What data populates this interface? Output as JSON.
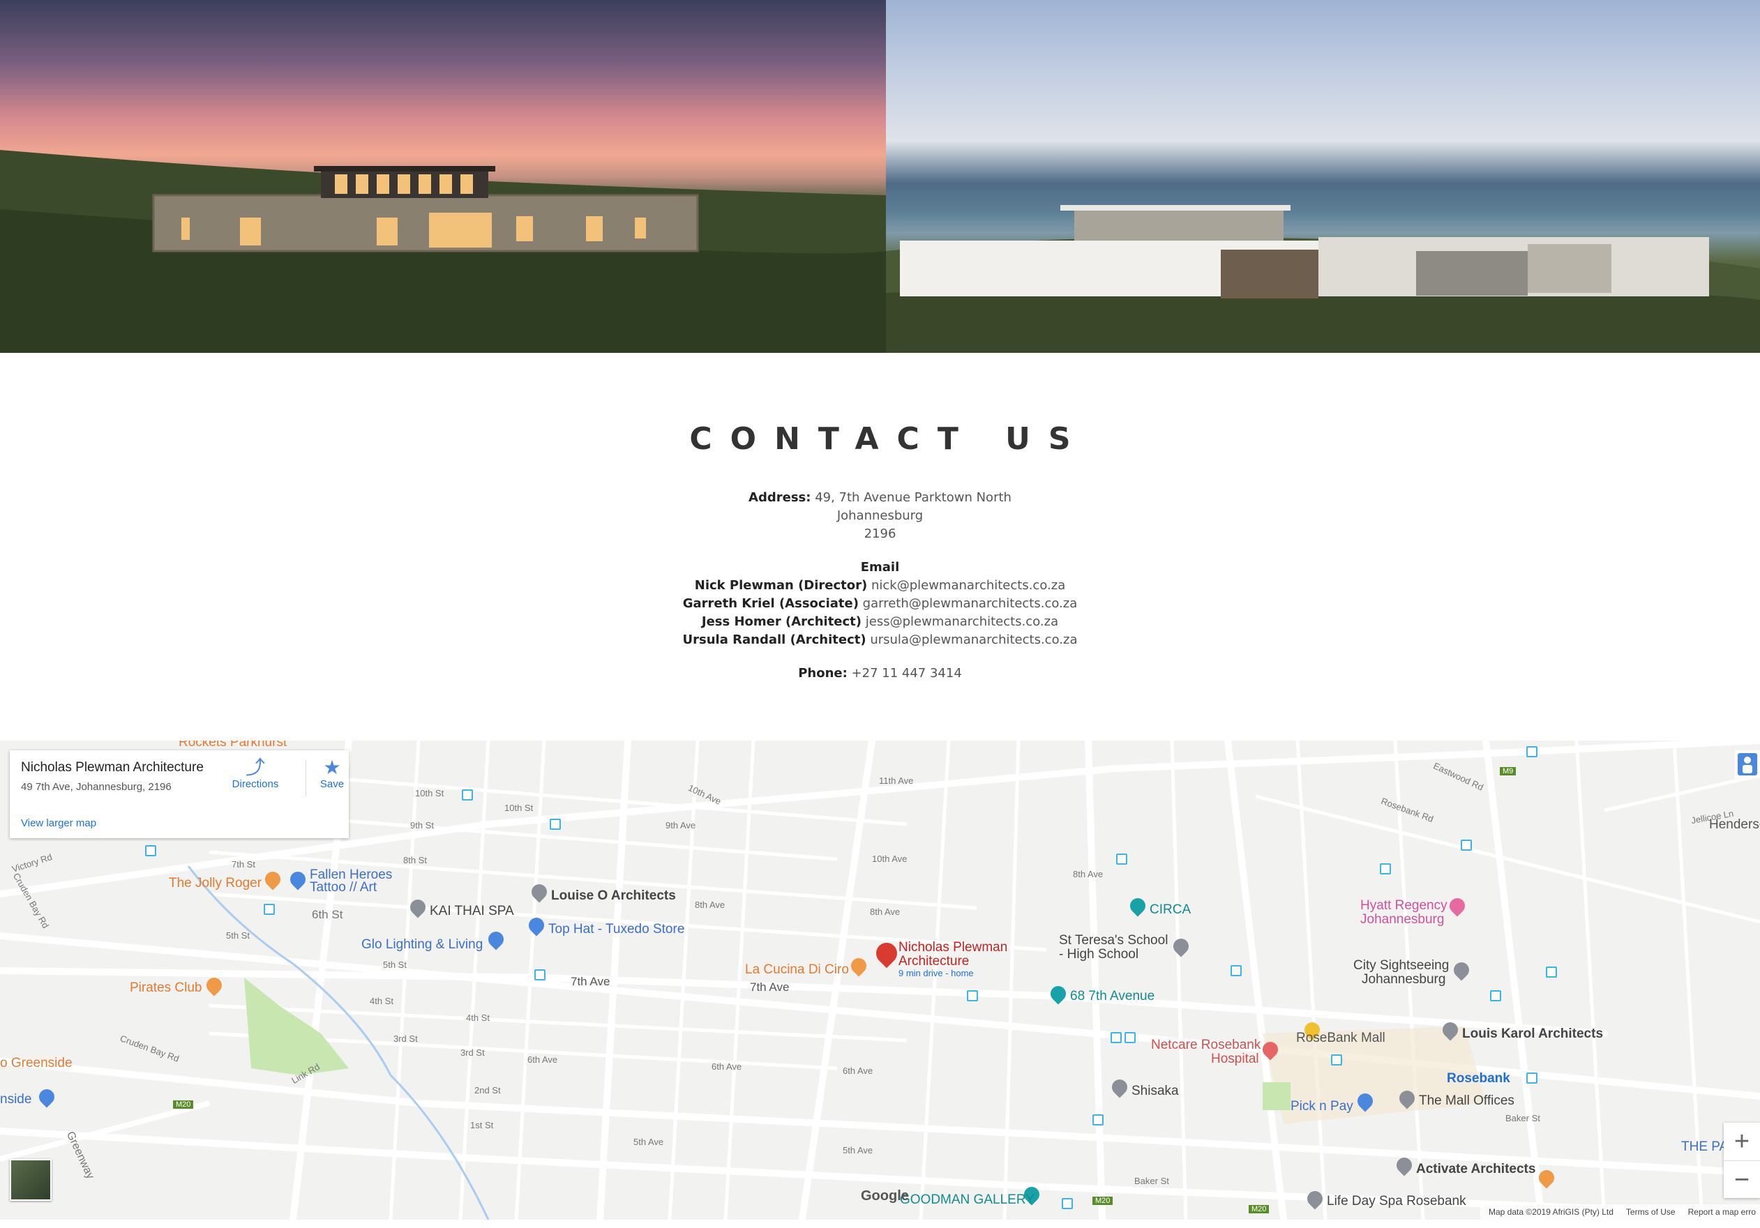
{
  "contact": {
    "title": "CONTACT US",
    "address_label": "Address:",
    "address_line1": "49, 7th Avenue Parktown North",
    "address_line2": "Johannesburg",
    "address_line3": "2196",
    "email_heading": "Email",
    "emails": [
      {
        "name": "Nick Plewman (Director)",
        "email": "nick@plewmanarchitects.co.za"
      },
      {
        "name": "Garreth Kriel (Associate)",
        "email": "garreth@plewmanarchitects.co.za"
      },
      {
        "name": "Jess Homer (Architect)",
        "email": "jess@plewmanarchitects.co.za"
      },
      {
        "name": "Ursula Randall (Architect)",
        "email": "ursula@plewmanarchitects.co.za"
      }
    ],
    "phone_label": "Phone:",
    "phone": "+27 11 447 3414"
  },
  "map": {
    "card": {
      "title": "Nicholas Plewman Architecture",
      "address": "49 7th Ave, Johannesburg, 2196",
      "directions": "Directions",
      "save": "Save",
      "larger_map": "View larger map"
    },
    "marker": {
      "name_line1": "Nicholas Plewman",
      "name_line2": "Architecture",
      "sub": "9 min drive - home"
    },
    "pois": {
      "jolly_roger": "The Jolly Roger",
      "fallen_heroes": "Fallen Heroes",
      "fallen_heroes2": "Tattoo // Art",
      "kai_thai": "KAI THAI SPA",
      "louise": "Louise O Architects",
      "top_hat": "Top Hat - Tuxedo Store",
      "glo": "Glo Lighting & Living",
      "pirates": "Pirates Club",
      "la_cucina": "La Cucina Di Ciro",
      "circa": "CIRCA",
      "teresa1": "St Teresa's School",
      "teresa2": "- High School",
      "ave68": "68 7th Avenue",
      "hyatt1": "Hyatt Regency",
      "hyatt2": "Johannesburg",
      "city1": "City Sightseeing",
      "city2": "Johannesburg",
      "rosebank_mall": "RoseBank Mall",
      "louis_karol": "Louis Karol Architects",
      "netcare1": "Netcare Rosebank",
      "netcare2": "Hospital",
      "rosebank": "Rosebank",
      "shisaka": "Shisaka",
      "pick_n_pay": "Pick n Pay",
      "mall_offices": "The Mall Offices",
      "activate": "Activate Architects",
      "life_day": "Life Day Spa Rosebank",
      "goodman": "GOODMAN GALLERY",
      "greenside": "o Greenside",
      "nside": "nside",
      "rockets": "Rockets Parkhurst",
      "henderson": "Henderso",
      "the_p": "THE PA"
    },
    "streets": {
      "victory_rd": "Victory Rd",
      "cruden_bay": "Cruden Bay Rd",
      "s10th": "10th St",
      "s9th": "9th St",
      "s8th": "8th St",
      "s7th": "7th St",
      "s6th": "6th St",
      "s5th": "5th St",
      "s4th": "4th St",
      "s3rd": "3rd St",
      "s2nd": "2nd St",
      "s1st": "1st St",
      "a11th": "11th Ave",
      "a10th": "10th Ave",
      "a9th": "9th Ave",
      "a8th": "8th Ave",
      "a7th": "7th Ave",
      "a6th": "6th Ave",
      "a5th": "5th Ave",
      "rosebank_rd": "Rosebank Rd",
      "eastwood_rd": "Eastwood Rd",
      "jellicoe": "Jellicoe Ln",
      "baker_st": "Baker St",
      "greenway": "Greenway",
      "link_rd": "Link Rd",
      "m20": "M20",
      "m9": "M9"
    },
    "zoom_in": "+",
    "zoom_out": "−",
    "google": "Google",
    "footer": {
      "data": "Map data ©2019 AfriGIS (Pty) Ltd",
      "terms": "Terms of Use",
      "report": "Report a map erro"
    },
    "colors": {
      "marker": "#d93b30",
      "link": "#1a73e8",
      "park": "#c7e6b0",
      "water": "#a9cdf0"
    }
  }
}
